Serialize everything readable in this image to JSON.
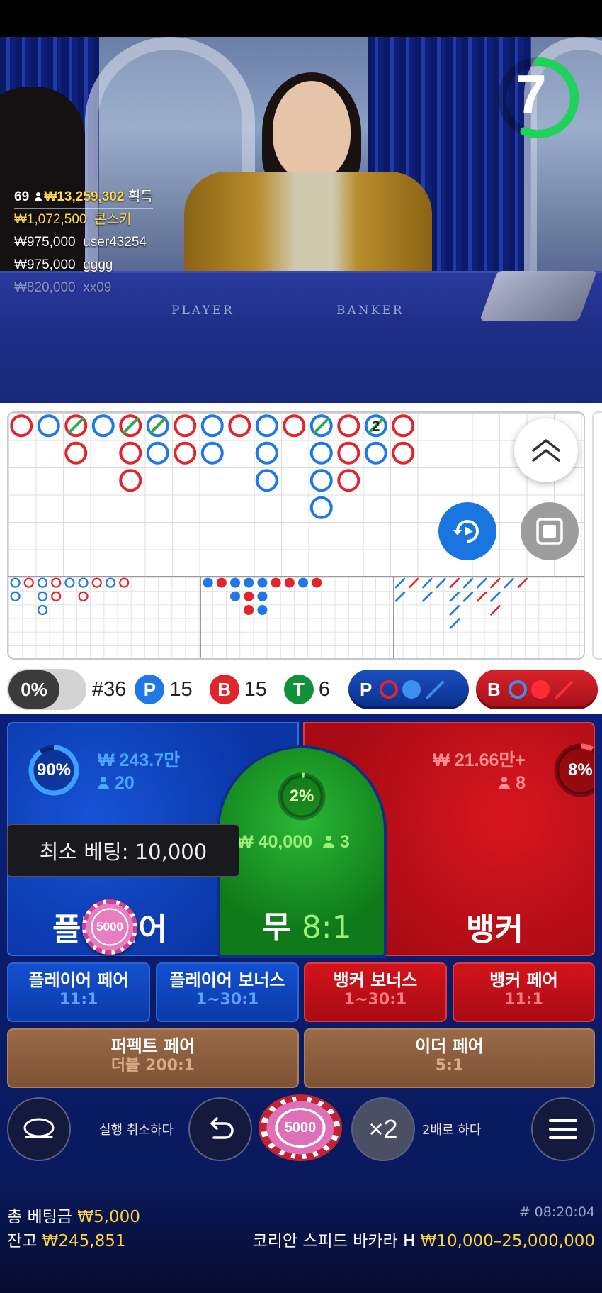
{
  "video": {
    "countdown": "7",
    "felt_player": "PLAYER",
    "felt_banker": "BANKER",
    "winners": {
      "count": "69",
      "total": "₩13,259,302",
      "suffix": "획득",
      "rows": [
        {
          "amount": "₩1,072,500",
          "name": "콘스키"
        },
        {
          "amount": "₩975,000",
          "name": "user43254"
        },
        {
          "amount": "₩975,000",
          "name": "gggg"
        },
        {
          "amount": "₩820,000",
          "name": "xx09"
        }
      ]
    }
  },
  "roadmap": {
    "big_road_marker": "2",
    "colors": {
      "player": "#1f78e6",
      "banker": "#e0262c",
      "tie": "#2fa84f"
    }
  },
  "stats": {
    "percent_toggle": "0%",
    "round": "#36",
    "player_label": "P",
    "player_count": "15",
    "banker_label": "B",
    "banker_count": "15",
    "tie_label": "T",
    "tie_count": "6",
    "predict_player": "P",
    "predict_banker": "B",
    "colors": {
      "player": "#1f78e6",
      "banker": "#e0262c",
      "tie": "#12913a"
    }
  },
  "bets": {
    "player": {
      "percent": "90%",
      "percent_value": 0.9,
      "amount": "₩ 243.7만",
      "players": "20",
      "title": "플레이어"
    },
    "tie": {
      "percent": "2%",
      "percent_value": 0.02,
      "amount": "₩ 40,000",
      "players": "3",
      "title": "무",
      "odds": "8:1"
    },
    "banker": {
      "percent": "8%",
      "percent_value": 0.08,
      "amount": "₩ 21.66만+",
      "players": "8",
      "title": "뱅커"
    },
    "min_bet_tooltip": "최소 베팅: 10,000",
    "placed_chip": "5000",
    "side_bets": [
      {
        "title": "플레이어 페어",
        "odds": "11:1"
      },
      {
        "title": "플레이어 보너스",
        "odds": "1~30:1"
      },
      {
        "title": "뱅커 보너스",
        "odds": "1~30:1"
      },
      {
        "title": "뱅커 페어",
        "odds": "11:1"
      },
      {
        "title": "퍼펙트 페어",
        "odds": "더블 200:1"
      },
      {
        "title": "이더 페어",
        "odds": "5:1"
      }
    ]
  },
  "controls": {
    "undo_label": "실행 취소하다",
    "chip_value": "5000",
    "double_symbol": "×2",
    "double_label": "2배로 하다"
  },
  "footer": {
    "total_bet_label": "총 베팅금",
    "total_bet": "₩5,000",
    "balance_label": "잔고",
    "balance": "₩245,851",
    "round_id": "# 08:20:04",
    "table_name": "코리안 스피드 바카라 H",
    "limits": "₩10,000–25,000,000"
  }
}
